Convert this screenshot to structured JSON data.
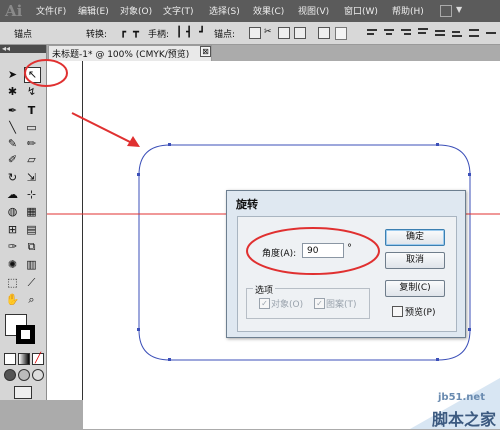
{
  "app": {
    "logo": "Ai"
  },
  "menu": {
    "items": [
      "文件(F)",
      "编辑(E)",
      "对象(O)",
      "文字(T)",
      "选择(S)",
      "效果(C)",
      "视图(V)",
      "窗口(W)",
      "帮助(H)"
    ]
  },
  "control_bar": {
    "anchor_label": "锚点",
    "convert_label": "转换:",
    "handles_label": "手柄:",
    "anchors_label": "锚点:"
  },
  "document_tab": {
    "title": "未标题-1* @ 100% (CMYK/预览)",
    "close": "⊠"
  },
  "dialog": {
    "title": "旋转",
    "angle_label": "角度(A):",
    "angle_value": "90",
    "degree_symbol": "°",
    "options_title": "选项",
    "objects_label": "对象(O)",
    "patterns_label": "图案(T)",
    "ok_label": "确定",
    "cancel_label": "取消",
    "copy_label": "复制(C)",
    "preview_label": "预览(P)"
  },
  "watermark": {
    "site": "jb51.net",
    "name": "脚本之家"
  },
  "colors": {
    "guide": "#e03030",
    "annotation": "#e03030",
    "path": "#3b4fb8",
    "menubar": "#5b5b5b"
  }
}
